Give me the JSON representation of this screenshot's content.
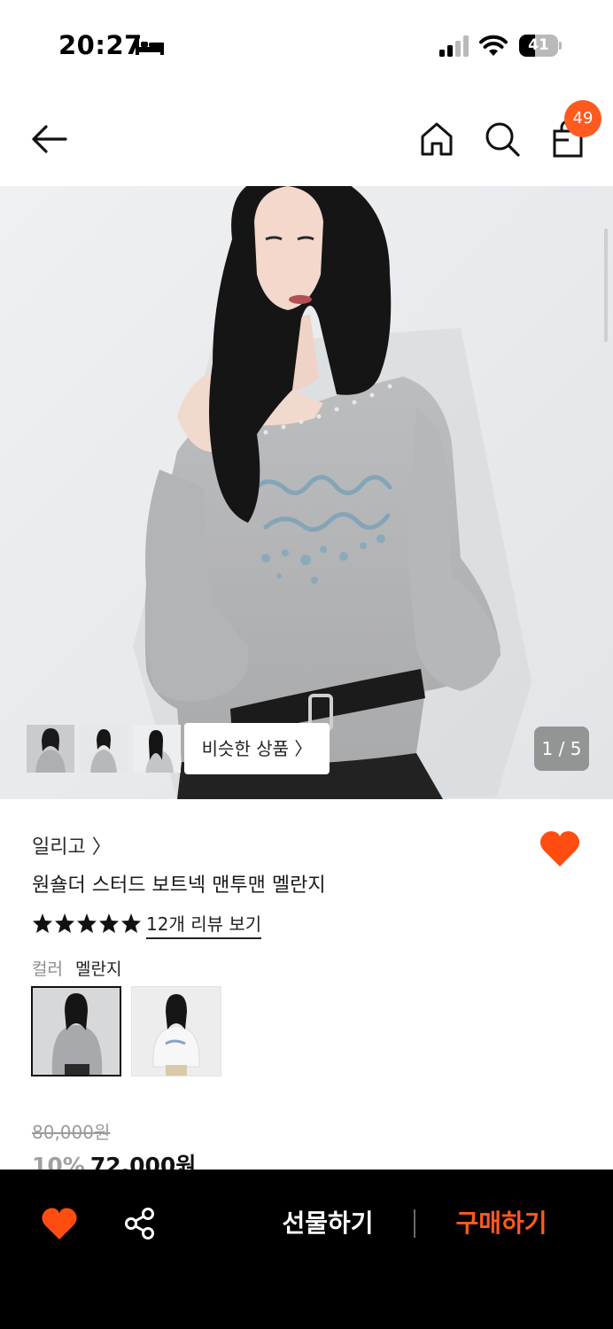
{
  "status_bar": {
    "time": "20:27",
    "battery": "41",
    "battery_level": 0.41,
    "icons": [
      "bed-icon",
      "signal-icon",
      "wifi-icon",
      "battery-icon"
    ]
  },
  "header": {
    "icons": [
      "back-arrow-icon",
      "home-icon",
      "search-icon",
      "shopping-bag-icon"
    ],
    "cart_count": "49"
  },
  "gallery": {
    "similar_products_label": "비슷한 상품 〉",
    "page_indicator": "1 / 5",
    "thumbnail_count": 3
  },
  "product": {
    "brand": "일리고 〉",
    "title": "원숄더 스터드 보트넥 맨투맨 멜란지",
    "rating_stars": 5,
    "review_link": "12개 리뷰 보기",
    "color_label": "컬러",
    "color_value": "멜란지",
    "original_price": "80,000원",
    "discount": "10%",
    "sale_price": "72,000원",
    "wishlisted": true
  },
  "bottom_bar": {
    "icons": [
      "heart-icon",
      "share-icon"
    ],
    "gift_label": "선물하기",
    "buy_label": "구매하기"
  },
  "colors": {
    "accent": "#ff5a1f",
    "bottom_bar_bg": "#000000"
  }
}
